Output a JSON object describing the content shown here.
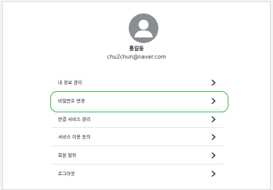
{
  "profile": {
    "name": "홍길동",
    "email": "chu2chun@naver.com"
  },
  "menu": {
    "items": [
      {
        "label": "내 정보 관리"
      },
      {
        "label": "비밀번호 변경"
      },
      {
        "label": "연결 서비스 관리"
      },
      {
        "label": "서비스 이용 동의"
      },
      {
        "label": "회원 탈퇴"
      },
      {
        "label": "로그아웃"
      }
    ]
  },
  "highlight": {
    "target": "비밀번호 변경",
    "color": "#3cb34a"
  },
  "colors": {
    "avatar": "#8a8d93",
    "background": "#f2f3f5",
    "panel": "#ffffff"
  }
}
